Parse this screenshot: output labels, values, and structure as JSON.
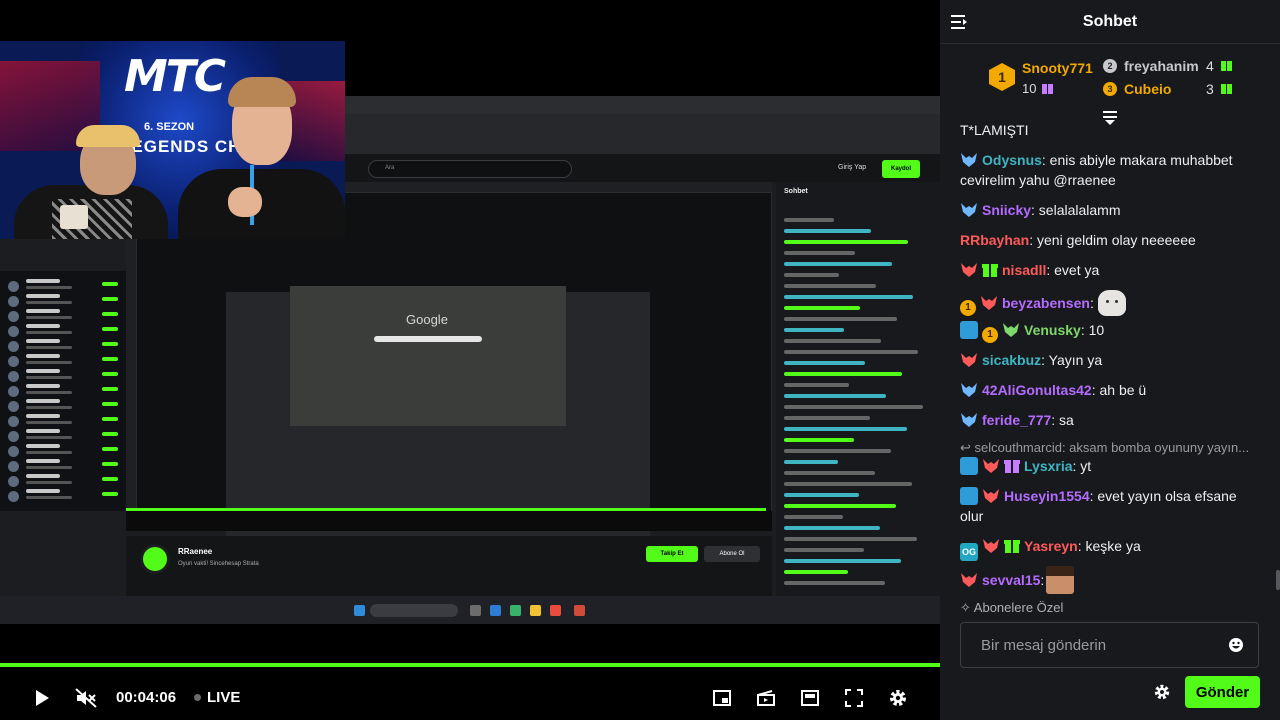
{
  "player": {
    "time": "00:04:06",
    "live_label": "LIVE",
    "progress_fraction": 1.0,
    "controls": [
      {
        "name": "play-icon"
      },
      {
        "name": "mute-icon"
      },
      {
        "name": "theater-mode-icon"
      },
      {
        "name": "clip-icon"
      },
      {
        "name": "mini-player-icon"
      },
      {
        "name": "fullscreen-icon"
      },
      {
        "name": "settings-gear-icon"
      }
    ],
    "accent_color": "#53fc18"
  },
  "stream_overlay": {
    "banner_logo": "MTC",
    "banner_line1": "6. SEZON",
    "banner_line2": "LEGENDS CHAMP",
    "screen": {
      "search_placeholder": "Ara",
      "login": "Giriş Yap",
      "register": "Kaydol",
      "chat_title": "Sohbet",
      "google": "Google",
      "channel_name": "RRaenee",
      "channel_title": "Oyun vakti! Sincehesap Strata",
      "follow": "Takip Et",
      "subscribe": "Abone Ol"
    }
  },
  "chat": {
    "title": "Sohbet",
    "top_gifters": [
      {
        "rank": "1",
        "name": "Snooty771",
        "count": "10",
        "color": "#f2a900"
      },
      {
        "rank": "2",
        "name": "freyahanim",
        "count": "4",
        "color": "#c8c8cc"
      },
      {
        "rank": "3",
        "name": "Cubeio",
        "count": "3",
        "color": "#f2a900"
      }
    ],
    "messages": [
      {
        "user": "",
        "text": "T*LAMIŞTI"
      },
      {
        "user": "Odysnus",
        "color": "#3fb5c4",
        "text": ": enis abiyle makara muhabbet cevirelim yahu @rraenee"
      },
      {
        "user": "Sniicky",
        "color": "#b56bff",
        "text": ": selalalalamm"
      },
      {
        "user": "RRbayhan",
        "color": "#ff5a5a",
        "text": ": yeni geldim olay neeeeee"
      },
      {
        "user": "nisadll",
        "color": "#ff5a5a",
        "text": ": evet ya"
      },
      {
        "user": "beyzabensen",
        "color": "#b56bff",
        "text": ":"
      },
      {
        "user": "Venusky",
        "color": "#7dd96b",
        "text": ": 10"
      },
      {
        "user": "sicakbuz",
        "color": "#3fb5c4",
        "text": ": Yayın ya"
      },
      {
        "user": "42AliGonultas42",
        "color": "#b56bff",
        "text": ": ah be ü"
      },
      {
        "user": "feride_777",
        "color": "#b56bff",
        "text": ": sa"
      },
      {
        "reply": "selcouthmarcid: aksam bomba oyununy yayın..."
      },
      {
        "user": "Lysxria",
        "color": "#3fb5c4",
        "text": ": yt"
      },
      {
        "user": "Huseyin1554",
        "color": "#b56bff",
        "text": ": evet yayın olsa efsane olur"
      },
      {
        "user": "Yasreyn",
        "color": "#ff5a5a",
        "text": ": keşke ya"
      },
      {
        "user": "sevval15",
        "color": "#b56bff",
        "text": ":"
      }
    ],
    "sub_only_label": "Abonelere Özel",
    "input_placeholder": "Bir mesaj gönderin",
    "send_label": "Gönder"
  }
}
